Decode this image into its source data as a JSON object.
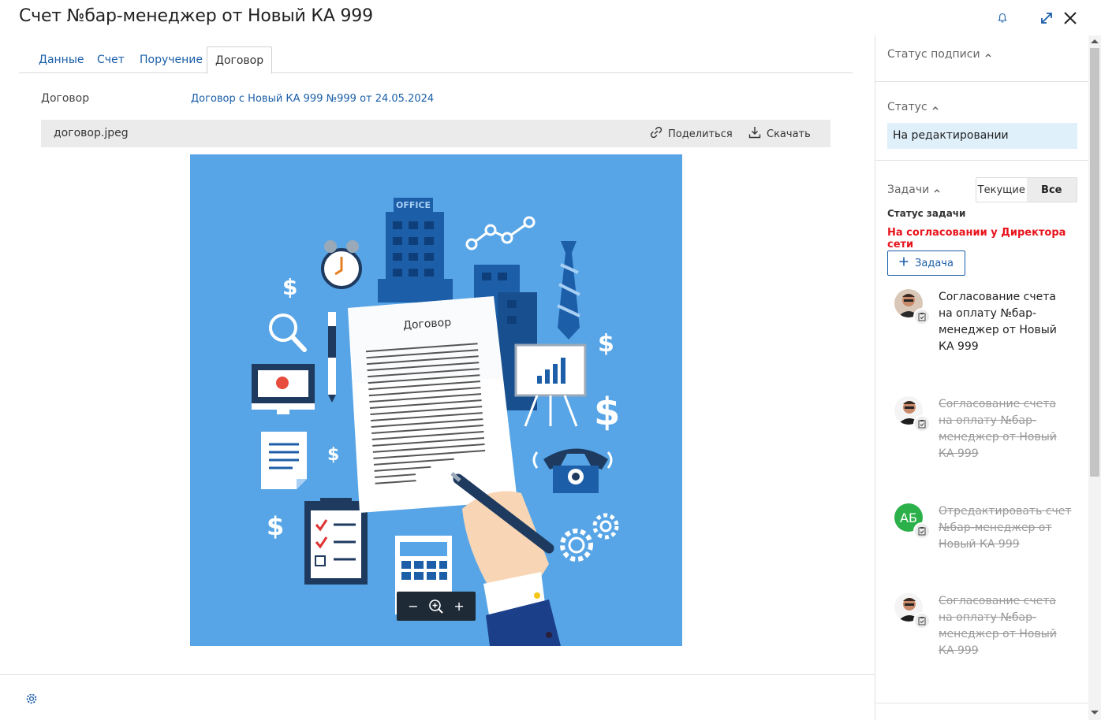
{
  "header": {
    "title": "Счет №бар-менеджер от Новый КА 999"
  },
  "tabs": [
    {
      "label": "Данные"
    },
    {
      "label": "Счет"
    },
    {
      "label": "Поручение"
    },
    {
      "label": "Договор",
      "active": true
    }
  ],
  "contract": {
    "label": "Договор",
    "link": "Договор с Новый КА 999 №999 от 24.05.2024"
  },
  "file": {
    "name": "договор.jpeg",
    "share_label": "Поделиться",
    "download_label": "Скачать",
    "image_caption": "Договор",
    "image_sign": "OFFICE"
  },
  "zoom": {
    "minus": "−",
    "plus": "+"
  },
  "right_panel": {
    "signature_status_label": "Статус подписи",
    "status_label": "Статус",
    "status_value": "На редактировании",
    "tasks_label": "Задачи",
    "filter_current": "Текущие",
    "filter_all": "Все",
    "task_status_label": "Статус задачи",
    "task_status_value": "На согласовании у Директора сети",
    "add_task_label": "Задача",
    "tasks": [
      {
        "text": "Согласование счета на оплату №бар-менеджер от Новый КА 999",
        "done": false,
        "avatar": "photo"
      },
      {
        "text": "Согласование счета на оплату №бар-менеджер от Новый КА 999",
        "done": true,
        "avatar": "photo"
      },
      {
        "text": "Отредактировать счет №бар-менеджер от Новый КА 999",
        "done": true,
        "avatar": "initials",
        "initials": "АБ"
      },
      {
        "text": "Согласование счета на оплату №бар-менеджер от Новый КА 999",
        "done": true,
        "avatar": "photo"
      }
    ]
  },
  "colors": {
    "accent": "#1a5ea8",
    "status_bg": "#dff0fa",
    "alert": "#e8141c",
    "image_bg": "#57a5e6",
    "avatar_green": "#2bb04a"
  }
}
